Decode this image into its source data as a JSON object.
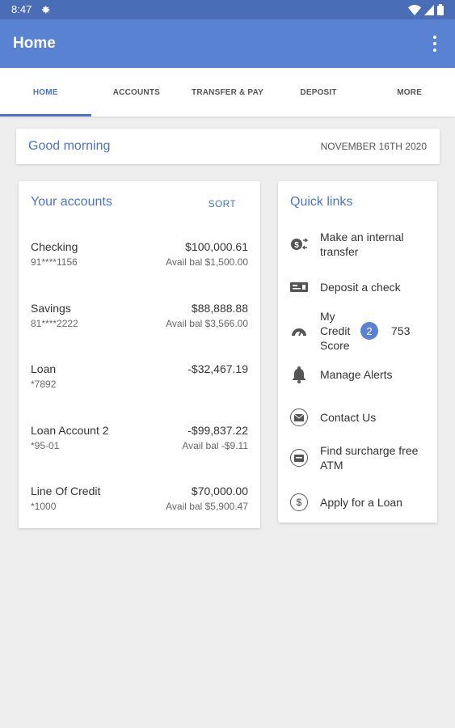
{
  "status_bar": {
    "time": "8:47"
  },
  "app_bar": {
    "title": "Home"
  },
  "tabs": [
    {
      "label": "HOME",
      "active": true
    },
    {
      "label": "ACCOUNTS",
      "active": false
    },
    {
      "label": "TRANSFER & PAY",
      "active": false
    },
    {
      "label": "DEPOSIT",
      "active": false
    },
    {
      "label": "MORE",
      "active": false
    }
  ],
  "greeting": {
    "text": "Good morning",
    "date": "NOVEMBER 16TH 2020"
  },
  "accounts_card": {
    "title": "Your accounts",
    "sort_label": "SORT",
    "items": [
      {
        "name": "Checking",
        "number": "91****1156",
        "balance": "$100,000.61",
        "avail": "Avail bal $1,500.00"
      },
      {
        "name": "Savings",
        "number": "81****2222",
        "balance": "$88,888.88",
        "avail": "Avail bal $3,566.00"
      },
      {
        "name": "Loan",
        "number": "*7892",
        "balance": "-$32,467.19",
        "avail": ""
      },
      {
        "name": "Loan Account 2",
        "number": "*95-01",
        "balance": "-$99,837.22",
        "avail": "Avail bal -$9.11"
      },
      {
        "name": "Line Of Credit",
        "number": "*1000",
        "balance": "$70,000.00",
        "avail": "Avail bal $5,900.47"
      }
    ]
  },
  "quick_links": {
    "title": "Quick links",
    "internal_transfer": {
      "label": "Make an internal transfer",
      "icon": "transfer-icon"
    },
    "deposit_check": {
      "label": "Deposit a check",
      "icon": "check-icon"
    },
    "credit_score": {
      "label": "My Credit Score",
      "badge": "2",
      "score": "753",
      "icon": "gauge-icon"
    },
    "alerts": {
      "label": "Manage Alerts",
      "icon": "bell-icon"
    },
    "contact": {
      "label": "Contact Us",
      "icon": "mail-icon"
    },
    "atm": {
      "label": "Find surcharge free ATM",
      "icon": "atm-icon"
    },
    "loan": {
      "label": "Apply for a Loan",
      "icon": "dollar-icon",
      "glyph": "$"
    }
  },
  "colors": {
    "status_bar": "#4a6db8",
    "app_bar": "#5a82d2",
    "accent": "#4a74c9",
    "background": "#eeeeee"
  }
}
